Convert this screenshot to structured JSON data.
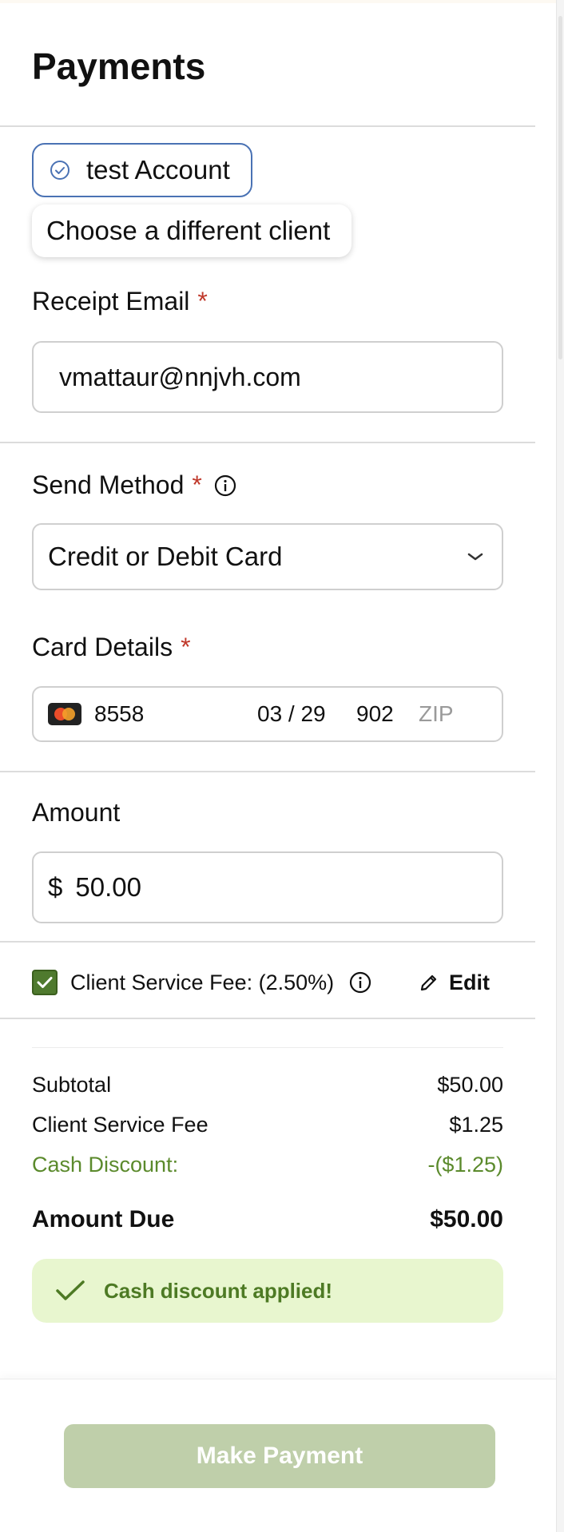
{
  "page": {
    "title": "Payments"
  },
  "client": {
    "selected": "test Account",
    "choose_label": "Choose a different client"
  },
  "receipt_email": {
    "label": "Receipt Email",
    "required_mark": "*",
    "value": "vmattaur@nnjvh.com"
  },
  "send_method": {
    "label": "Send Method",
    "required_mark": "*",
    "value": "Credit or Debit Card"
  },
  "card_details": {
    "label": "Card Details",
    "required_mark": "*",
    "brand_icon": "mastercard-icon",
    "number": "8558",
    "expiry": "03 / 29",
    "cvc": "902",
    "zip_placeholder": "ZIP"
  },
  "amount": {
    "label": "Amount",
    "currency": "$",
    "value": "50.00"
  },
  "service_fee": {
    "checked": true,
    "label": "Client Service Fee: (2.50%)",
    "edit_label": "Edit"
  },
  "summary": {
    "subtotal_label": "Subtotal",
    "subtotal_value": "$50.00",
    "fee_label": "Client Service Fee",
    "fee_value": "$1.25",
    "discount_label": "Cash Discount:",
    "discount_value": "-($1.25)",
    "due_label": "Amount Due",
    "due_value": "$50.00"
  },
  "alert": {
    "text": "Cash discount applied!"
  },
  "footer": {
    "pay_label": "Make Payment"
  },
  "colors": {
    "accent_blue": "#4a72b4",
    "success_green": "#4d7a24",
    "alert_bg": "#e8f6cf",
    "button_disabled": "#bfcfaa",
    "required_red": "#c0392b"
  }
}
